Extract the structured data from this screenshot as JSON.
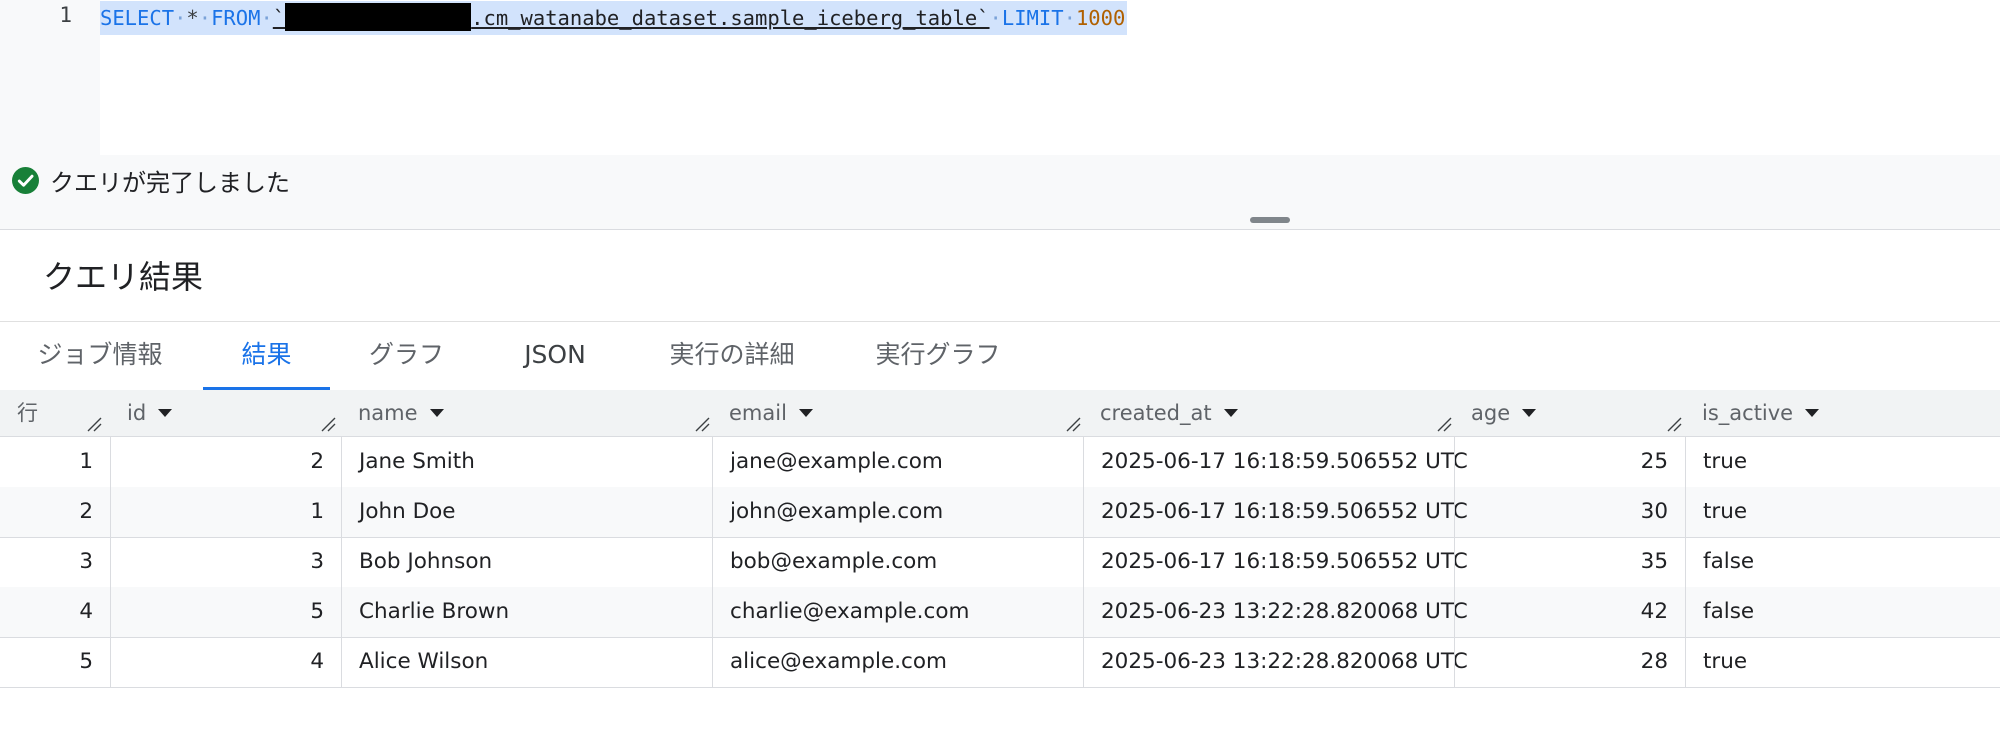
{
  "editor": {
    "line_number": "1",
    "sql": {
      "select": "SELECT",
      "star": "*",
      "from": "FROM",
      "backtick_open": "`",
      "table": ".cm_watanabe_dataset.sample_iceberg_table`",
      "limit": "LIMIT",
      "limit_value": "1000"
    }
  },
  "status": {
    "text": "クエリが完了しました"
  },
  "results": {
    "title": "クエリ結果",
    "tabs": [
      {
        "label": "ジョブ情報"
      },
      {
        "label": "結果"
      },
      {
        "label": "グラフ"
      },
      {
        "label": "JSON"
      },
      {
        "label": "実行の詳細"
      },
      {
        "label": "実行グラフ"
      }
    ],
    "active_tab": "結果",
    "columns": [
      "行",
      "id",
      "name",
      "email",
      "created_at",
      "age",
      "is_active"
    ],
    "rows": [
      {
        "row": "1",
        "id": "2",
        "name": "Jane Smith",
        "email": "jane@example.com",
        "created_at": "2025-06-17 16:18:59.506552 UTC",
        "age": "25",
        "is_active": "true"
      },
      {
        "row": "2",
        "id": "1",
        "name": "John Doe",
        "email": "john@example.com",
        "created_at": "2025-06-17 16:18:59.506552 UTC",
        "age": "30",
        "is_active": "true"
      },
      {
        "row": "3",
        "id": "3",
        "name": "Bob Johnson",
        "email": "bob@example.com",
        "created_at": "2025-06-17 16:18:59.506552 UTC",
        "age": "35",
        "is_active": "false"
      },
      {
        "row": "4",
        "id": "5",
        "name": "Charlie Brown",
        "email": "charlie@example.com",
        "created_at": "2025-06-23 13:22:28.820068 UTC",
        "age": "42",
        "is_active": "false"
      },
      {
        "row": "5",
        "id": "4",
        "name": "Alice Wilson",
        "email": "alice@example.com",
        "created_at": "2025-06-23 13:22:28.820068 UTC",
        "age": "28",
        "is_active": "true"
      }
    ]
  },
  "colors": {
    "accent": "#1a73e8",
    "success": "#188038",
    "selection": "#d2e3fc",
    "number": "#b06000"
  },
  "icons": {
    "status": "check-circle-icon",
    "sort": "arrow-drop-down-icon",
    "resize": "resize-handle-icon"
  }
}
